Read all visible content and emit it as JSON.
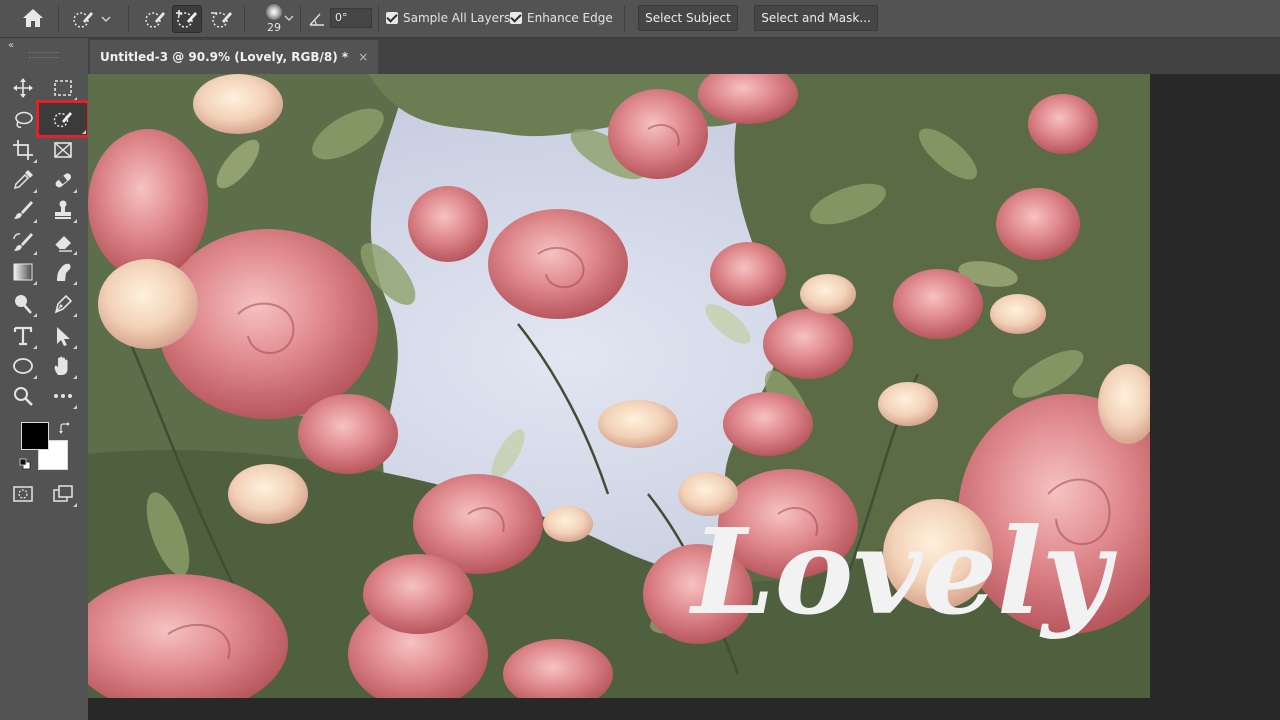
{
  "options_bar": {
    "brush_size": "29",
    "angle_value": "0°",
    "sample_all_layers": {
      "label": "Sample All Layers",
      "checked": true
    },
    "enhance_edge": {
      "label": "Enhance Edge",
      "checked": true
    },
    "select_subject_label": "Select Subject",
    "select_and_mask_label": "Select and Mask..."
  },
  "document": {
    "tab_title": "Untitled-3 @ 90.9% (Lovely, RGB/8) *",
    "tab_close": "×"
  },
  "toolbar": {
    "collapse_glyph": "«",
    "tools": [
      "move-icon",
      "marquee-icon",
      "lasso-icon",
      "quick-selection-icon",
      "crop-icon",
      "frame-icon",
      "eyedropper-icon",
      "healing-brush-icon",
      "brush-icon",
      "clone-stamp-icon",
      "history-brush-icon",
      "eraser-icon",
      "gradient-icon",
      "smudge-icon",
      "dodge-icon",
      "pen-icon",
      "type-icon",
      "path-selection-icon",
      "ellipse-icon",
      "hand-icon",
      "zoom-icon",
      "more-tools-icon",
      "quick-mask-icon",
      "screen-mode-icon"
    ],
    "selected_tool": "quick-selection-icon",
    "foreground_color": "#000000",
    "background_color": "#ffffff"
  },
  "canvas": {
    "overlay_text": "Lovely",
    "overlay_text_color": "#f2f2f2",
    "sky_color": "#c9cfe0"
  },
  "colors": {
    "highlight": "#e0222b",
    "panel": "#535353",
    "workspace": "#282828"
  }
}
